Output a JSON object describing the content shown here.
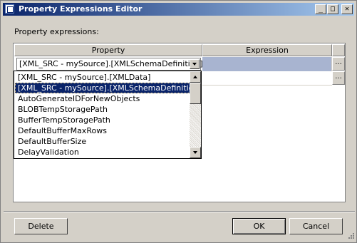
{
  "window": {
    "title": "Property Expressions Editor",
    "icon": "app-icon",
    "controls": {
      "minimize": "_",
      "maximize": "□",
      "close": "✕"
    }
  },
  "label": "Property expressions:",
  "grid": {
    "columns": [
      "Property",
      "Expression",
      ""
    ],
    "rows": [
      {
        "property": "[XML_SRC - mySource].[XMLSchemaDefinition]",
        "expression": "",
        "ellipsis": "..."
      },
      {
        "property": "",
        "expression": "",
        "ellipsis": "..."
      }
    ]
  },
  "dropdown": {
    "items": [
      "[XML_SRC - mySource].[XMLData]",
      "[XML_SRC - mySource].[XMLSchemaDefinition]",
      "AutoGenerateIDForNewObjects",
      "BLOBTempStoragePath",
      "BufferTempStoragePath",
      "DefaultBufferMaxRows",
      "DefaultBufferSize",
      "DelayValidation"
    ],
    "selected_index": 1
  },
  "buttons": {
    "delete": "Delete",
    "ok": "OK",
    "cancel": "Cancel"
  },
  "colors": {
    "titlebar_start": "#0a246a",
    "titlebar_end": "#a6caf0",
    "selection": "#0a246a",
    "expression_highlight": "#a8b4d0"
  }
}
